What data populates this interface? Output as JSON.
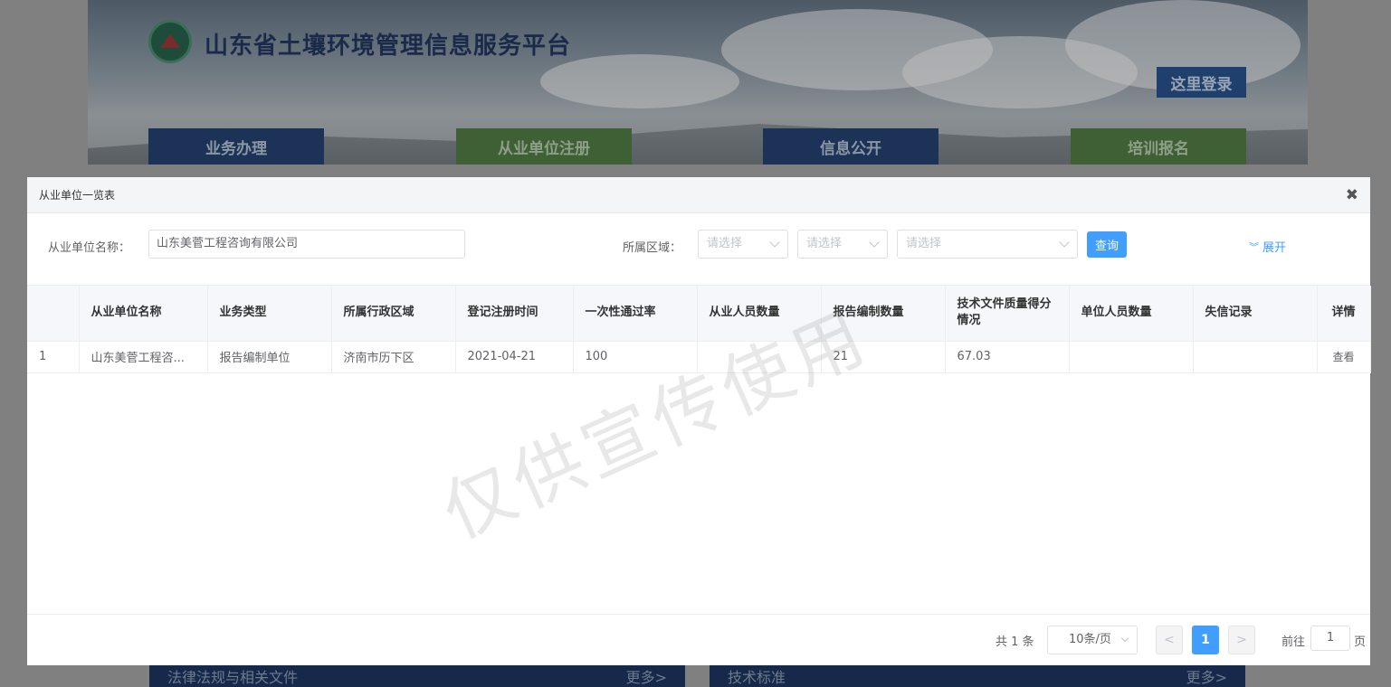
{
  "site": {
    "title": "山东省土壤环境管理信息服务平台",
    "login_label": "这里登录",
    "nav": [
      "业务办理",
      "从业单位注册",
      "信息公开",
      "培训报名"
    ],
    "bottom_panels": [
      {
        "title": "法律法规与相关文件",
        "more": "更多>"
      },
      {
        "title": "技术标准",
        "more": "更多>"
      }
    ]
  },
  "modal": {
    "title": "从业单位一览表",
    "close_icon": "close-icon",
    "filters": {
      "name_label": "从业单位名称：",
      "name_value": "山东美菅工程咨询有限公司",
      "region_label": "所属区域：",
      "region_placeholders": [
        "请选择",
        "请选择",
        "请选择"
      ],
      "query_label": "查询",
      "expand_label": "展开"
    },
    "table": {
      "columns": [
        "",
        "从业单位名称",
        "业务类型",
        "所属行政区域",
        "登记注册时间",
        "一次性通过率",
        "从业人员数量",
        "报告编制数量",
        "技术文件质量得分情况",
        "单位人员数量",
        "失信记录",
        "详情"
      ],
      "rows": [
        {
          "index": "1",
          "name": "山东美菅工程咨...",
          "type": "报告编制单位",
          "region": "济南市历下区",
          "reg_date": "2021-04-21",
          "pass_rate": "100",
          "staff_count": "",
          "report_count": "21",
          "quality_score": "67.03",
          "unit_staff": "",
          "dishonest": "",
          "detail": "查看"
        }
      ]
    },
    "watermark": "仅供宣传使用",
    "pagination": {
      "total": "共 1 条",
      "page_size": "10条/页",
      "prev": "<",
      "current": "1",
      "next": ">",
      "goto_label": "前往",
      "goto_value": "1",
      "page_suffix": "页"
    }
  },
  "colors": {
    "primary": "#409eff",
    "overlay": "#808080",
    "nav_dark": "#1c3357",
    "nav_green": "#3f6034"
  }
}
